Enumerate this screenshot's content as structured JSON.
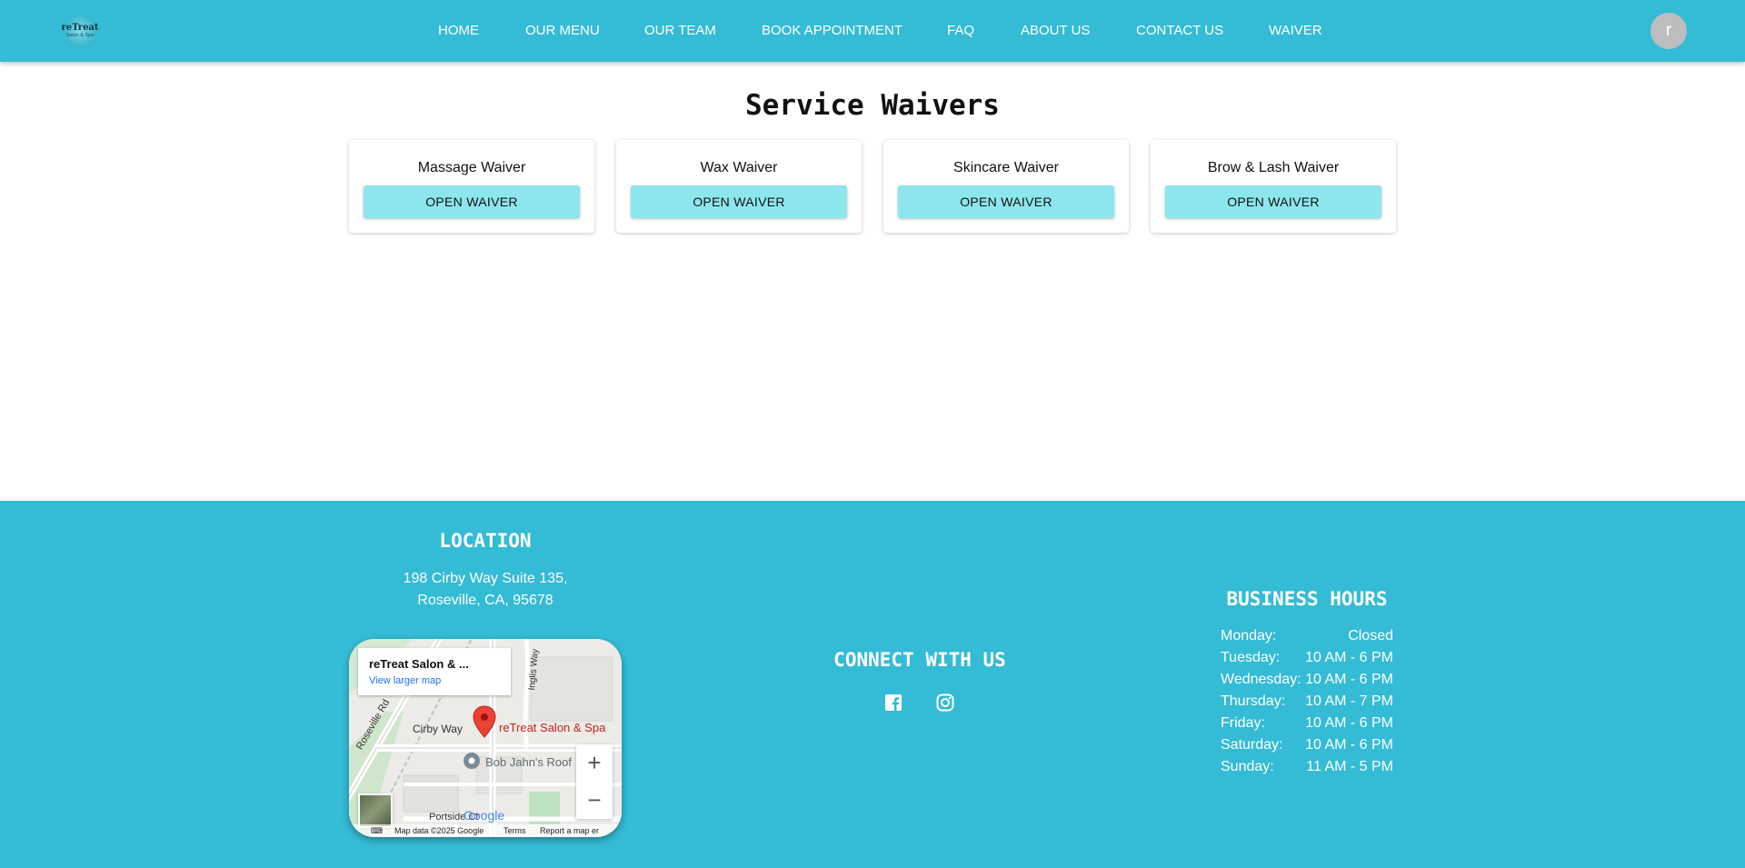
{
  "brand": {
    "logo_line1": "reTreat",
    "logo_line2": "Salon & Spa",
    "accent": "#34bbd5"
  },
  "nav": {
    "items": [
      {
        "label": "HOME"
      },
      {
        "label": "OUR MENU"
      },
      {
        "label": "OUR TEAM"
      },
      {
        "label": "BOOK APPOINTMENT"
      },
      {
        "label": "FAQ"
      },
      {
        "label": "ABOUT US"
      },
      {
        "label": "CONTACT US"
      },
      {
        "label": "WAIVER"
      }
    ],
    "avatar_initial": "r"
  },
  "main": {
    "title": "Service Waivers",
    "cards": [
      {
        "title": "Massage Waiver",
        "button": "OPEN WAIVER"
      },
      {
        "title": "Wax Waiver",
        "button": "OPEN WAIVER"
      },
      {
        "title": "Skincare Waiver",
        "button": "OPEN WAIVER"
      },
      {
        "title": "Brow & Lash Waiver",
        "button": "OPEN WAIVER"
      }
    ]
  },
  "footer": {
    "location": {
      "heading": "LOCATION",
      "address_line1": "198 Cirby Way Suite 135,",
      "address_line2": "Roseville, CA, 95678"
    },
    "map": {
      "place_name": "reTreat Salon & ...",
      "view_larger": "View larger map",
      "pin_label": "reTreat Salon & Spa",
      "poi_label": "Bob Jahn's Roof",
      "streets": [
        "Cirby Way",
        "Roseville Rd",
        "Inglis Way",
        "Portside Ct"
      ],
      "logo": "Google",
      "attribution": "Map data ©2025 Google",
      "terms": "Terms",
      "report": "Report a map er",
      "zoom_in": "+",
      "zoom_out": "−"
    },
    "connect": {
      "heading": "CONNECT WITH US",
      "icons": [
        "facebook-icon",
        "instagram-icon"
      ]
    },
    "hours": {
      "heading": "BUSINESS HOURS",
      "rows": [
        {
          "day": "Monday:",
          "time": "Closed"
        },
        {
          "day": "Tuesday:",
          "time": "10 AM - 6 PM"
        },
        {
          "day": "Wednesday:",
          "time": "10 AM - 6 PM"
        },
        {
          "day": "Thursday:",
          "time": "10 AM - 7 PM"
        },
        {
          "day": "Friday:",
          "time": "10 AM - 6 PM"
        },
        {
          "day": "Saturday:",
          "time": "10 AM - 6 PM"
        },
        {
          "day": "Sunday:",
          "time": "11 AM - 5 PM"
        }
      ]
    }
  }
}
